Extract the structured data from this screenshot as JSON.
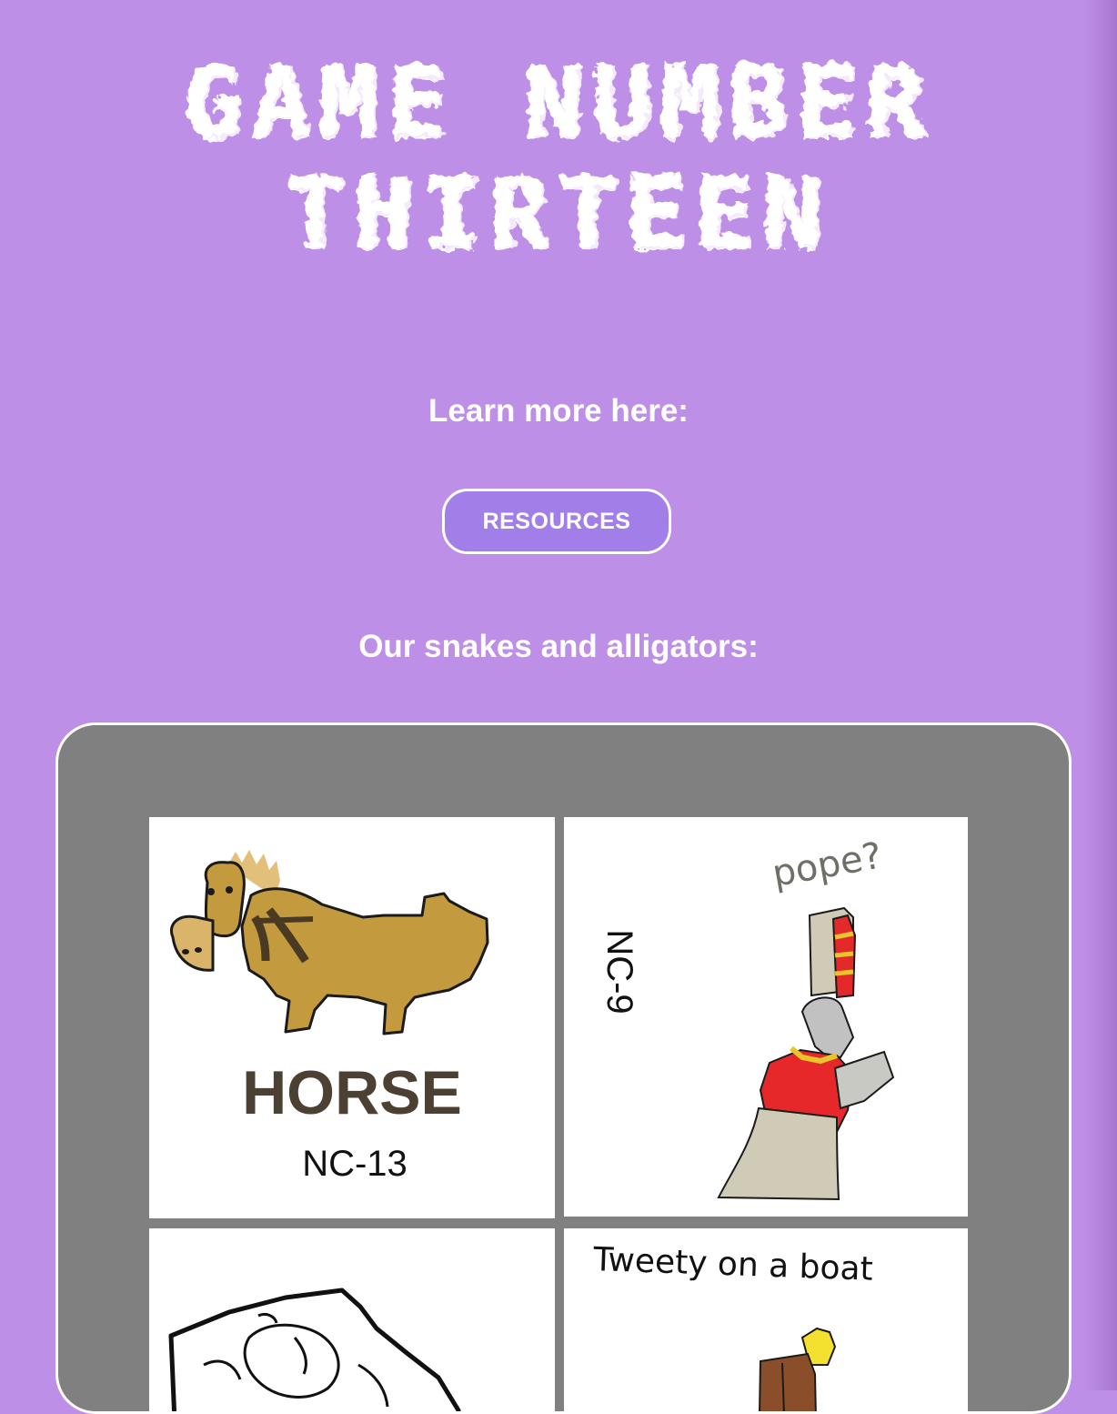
{
  "header": {
    "title_line1": "Game number",
    "title_line2": "thirteen"
  },
  "intro": {
    "learn_more": "Learn more here:",
    "resources_button": "RESOURCES"
  },
  "gallery": {
    "heading": "Our snakes and alligators:",
    "cards": [
      {
        "word": "HORSE",
        "code": "NC-13",
        "icon": "horse-drawing"
      },
      {
        "caption": "pope?",
        "code": "NC-9",
        "icon": "pope-drawing"
      },
      {
        "code": "",
        "icon": "map-drawing"
      },
      {
        "caption": "Tweety on a boat",
        "icon": "bird-on-boat-drawing"
      }
    ]
  },
  "colors": {
    "background": "#be8fe6",
    "button": "#a27fe8",
    "gallery_panel": "#808080",
    "text": "#ffffff"
  }
}
